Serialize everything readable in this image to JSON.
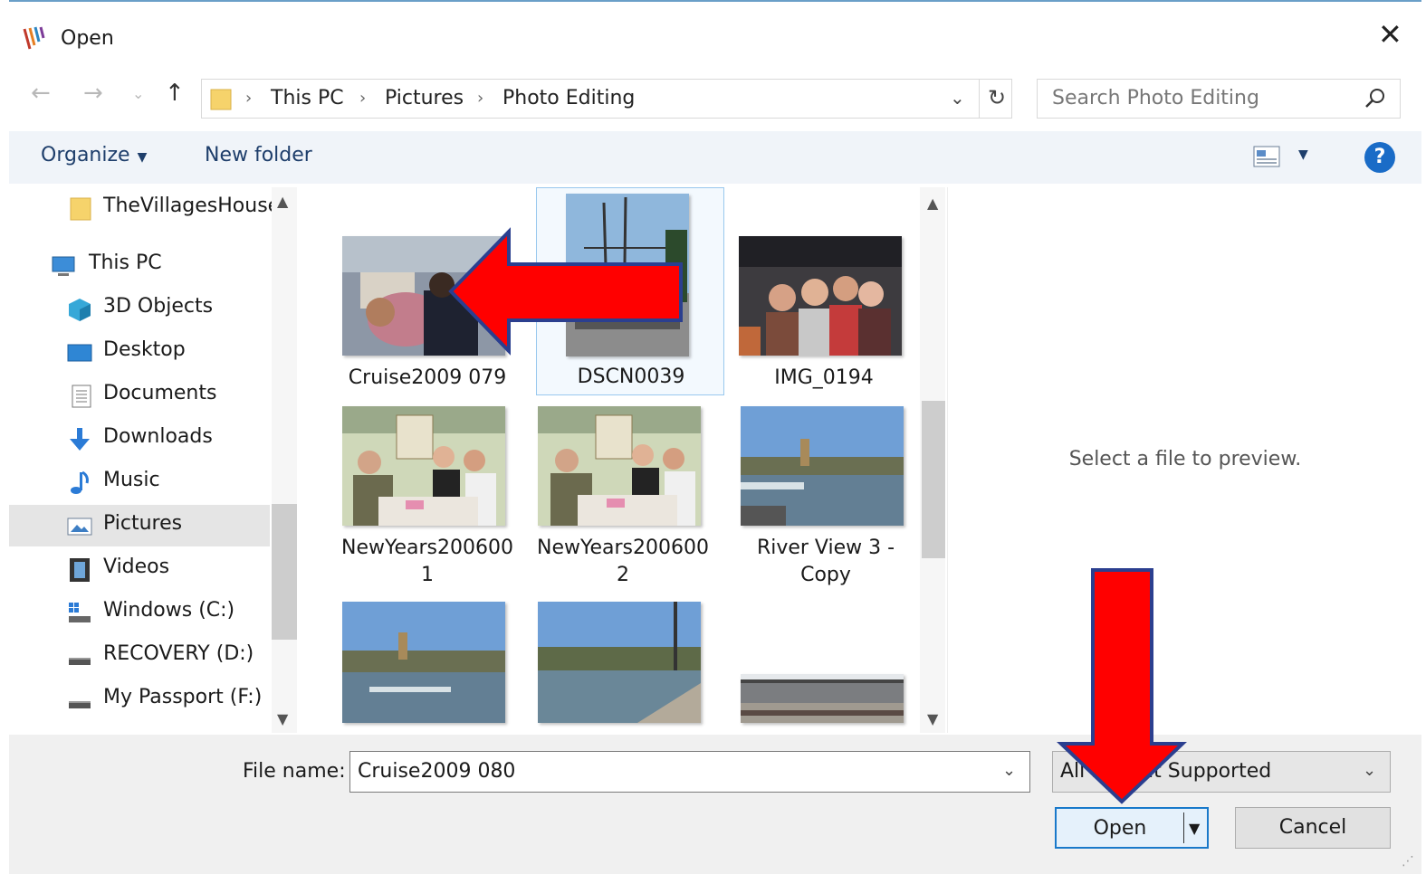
{
  "window": {
    "title": "Open",
    "close_glyph": "✕"
  },
  "nav": {
    "back_glyph": "←",
    "forward_glyph": "→",
    "recent_glyph": "⌄",
    "up_glyph": "↑",
    "breadcrumbs": [
      "This PC",
      "Pictures",
      "Photo Editing"
    ],
    "separator": "›",
    "dropdown_glyph": "⌄",
    "refresh_glyph": "↻"
  },
  "search": {
    "placeholder": "Search Photo Editing"
  },
  "toolbar": {
    "organize_label": "Organize",
    "organize_caret": "▼",
    "new_folder_label": "New folder",
    "view_caret": "▼",
    "help_label": "?"
  },
  "sidebar": {
    "items": [
      {
        "label": "TheVillagesHouse",
        "icon": "folder-icon"
      },
      {
        "label": "This PC",
        "icon": "computer-icon"
      },
      {
        "label": "3D Objects",
        "icon": "cube-icon"
      },
      {
        "label": "Desktop",
        "icon": "desktop-icon"
      },
      {
        "label": "Documents",
        "icon": "document-icon"
      },
      {
        "label": "Downloads",
        "icon": "download-icon"
      },
      {
        "label": "Music",
        "icon": "music-icon"
      },
      {
        "label": "Pictures",
        "icon": "pictures-icon"
      },
      {
        "label": "Videos",
        "icon": "video-icon"
      },
      {
        "label": "Windows (C:)",
        "icon": "drive-icon"
      },
      {
        "label": "RECOVERY (D:)",
        "icon": "drive-icon"
      },
      {
        "label": "My Passport (F:)",
        "icon": "drive-icon"
      }
    ],
    "selected": "Pictures"
  },
  "files": {
    "items": [
      {
        "line1": "Cruise2009 079",
        "line2": ""
      },
      {
        "line1": "DSCN0039",
        "line2": ""
      },
      {
        "line1": "IMG_0194",
        "line2": ""
      },
      {
        "line1": "NewYears200600",
        "line2": "1"
      },
      {
        "line1": "NewYears200600",
        "line2": "2"
      },
      {
        "line1": "River View 3 -",
        "line2": "Copy"
      },
      {
        "line1": "",
        "line2": ""
      },
      {
        "line1": "",
        "line2": ""
      },
      {
        "line1": "",
        "line2": ""
      }
    ],
    "selected": "DSCN0039"
  },
  "preview": {
    "text": "Select a file to preview."
  },
  "bottom": {
    "file_name_label": "File name:",
    "file_name_value": "Cruise2009 080",
    "file_type_value": "All Format Supported",
    "open_label": "Open",
    "open_caret": "▼",
    "cancel_label": "Cancel",
    "dropdown_glyph": "⌄"
  },
  "colors": {
    "accent": "#1979ca",
    "annotation_arrow": "#ff0000",
    "arrow_outline": "#2b3f8f"
  }
}
